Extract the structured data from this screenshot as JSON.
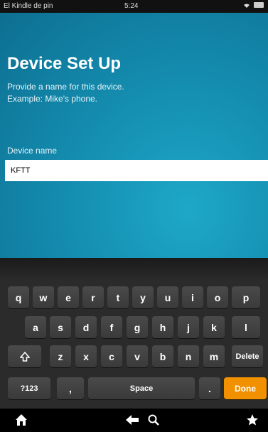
{
  "status_bar": {
    "device_name": "El Kindle de pin",
    "time": "5:24"
  },
  "setup": {
    "title": "Device Set Up",
    "description_line1": "Provide a name for this device.",
    "description_line2": "Example: Mike's phone.",
    "field_label": "Device name",
    "field_value": "KFTT"
  },
  "keyboard": {
    "row1": [
      "q",
      "w",
      "e",
      "r",
      "t",
      "y",
      "u",
      "i",
      "o",
      "p"
    ],
    "row2": [
      "a",
      "s",
      "d",
      "f",
      "g",
      "h",
      "j",
      "k",
      "l"
    ],
    "row3": [
      "z",
      "x",
      "c",
      "v",
      "b",
      "n",
      "m"
    ],
    "delete_label": "Delete",
    "mode_label": "?123",
    "comma_label": ",",
    "space_label": "Space",
    "period_label": ".",
    "done_label": "Done",
    "done_color": "#f29100"
  },
  "nav": {
    "icons": [
      "home-icon",
      "back-icon",
      "search-icon",
      "favorites-icon"
    ]
  }
}
